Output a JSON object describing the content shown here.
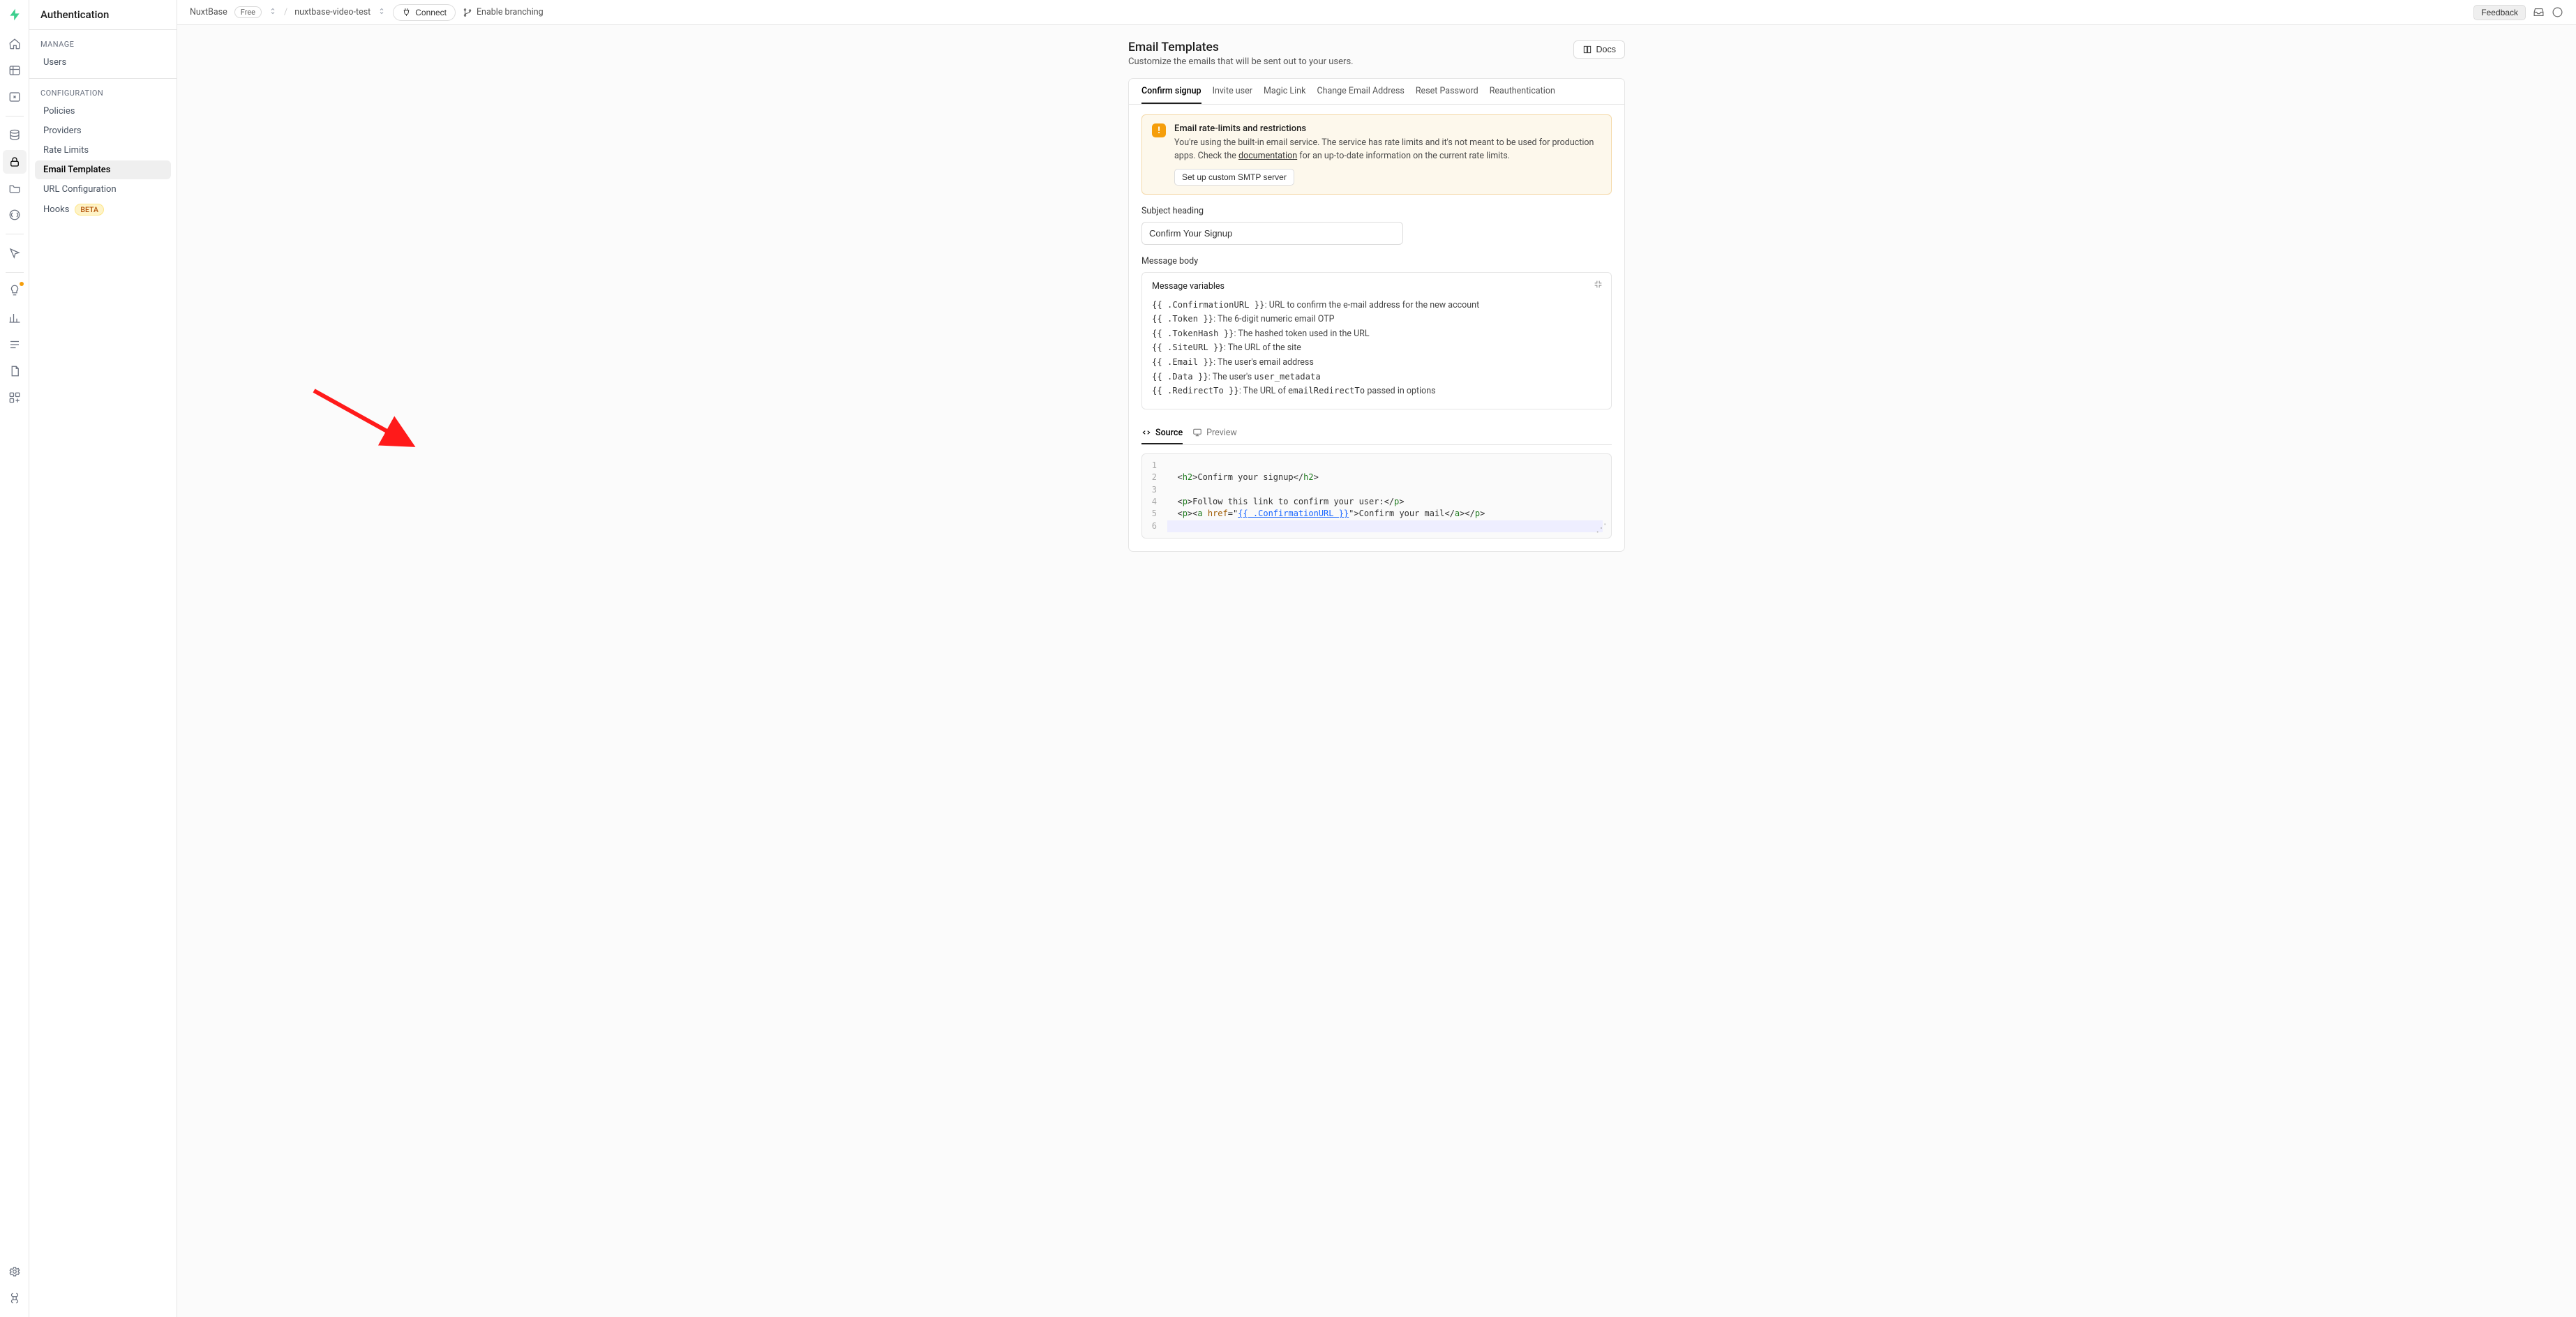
{
  "sidebar": {
    "title": "Authentication",
    "manage_header": "MANAGE",
    "config_header": "CONFIGURATION",
    "manage_items": [
      {
        "label": "Users"
      }
    ],
    "config_items": [
      {
        "label": "Policies"
      },
      {
        "label": "Providers"
      },
      {
        "label": "Rate Limits"
      },
      {
        "label": "Email Templates",
        "active": true
      },
      {
        "label": "URL Configuration"
      },
      {
        "label": "Hooks",
        "badge": "BETA"
      }
    ]
  },
  "topbar": {
    "org": "NuxtBase",
    "plan": "Free",
    "project": "nuxtbase-video-test",
    "connect": "Connect",
    "branching": "Enable branching",
    "feedback": "Feedback"
  },
  "page": {
    "title": "Email Templates",
    "subtitle": "Customize the emails that will be sent out to your users.",
    "docs": "Docs"
  },
  "tabs": [
    "Confirm signup",
    "Invite user",
    "Magic Link",
    "Change Email Address",
    "Reset Password",
    "Reauthentication"
  ],
  "notice": {
    "title": "Email rate-limits and restrictions",
    "text1": "You're using the built-in email service. The service has rate limits and it's not meant to be used for production apps. Check the ",
    "doclink": "documentation",
    "text2": " for an up-to-date information on the current rate limits.",
    "button": "Set up custom SMTP server"
  },
  "form": {
    "subject_label": "Subject heading",
    "subject_value": "Confirm Your Signup",
    "body_label": "Message body"
  },
  "vars": {
    "title": "Message variables",
    "items": [
      {
        "var": "{{ .ConfirmationURL }}",
        "desc": ": URL to confirm the e-mail address for the new account"
      },
      {
        "var": "{{ .Token }}",
        "desc": ": The 6-digit numeric email OTP"
      },
      {
        "var": "{{ .TokenHash }}",
        "desc": ": The hashed token used in the URL"
      },
      {
        "var": "{{ .SiteURL }}",
        "desc": ": The URL of the site"
      },
      {
        "var": "{{ .Email }}",
        "desc": ": The user's email address"
      },
      {
        "var": "{{ .Data }}",
        "desc_pre": ": The user's ",
        "code": "user_metadata"
      },
      {
        "var": "{{ .RedirectTo }}",
        "desc_pre": ": The URL of ",
        "code": "emailRedirectTo",
        "desc_post": " passed in options"
      }
    ]
  },
  "editor_tabs": {
    "source": "Source",
    "preview": "Preview"
  },
  "code": {
    "lines": [
      "1",
      "2",
      "3",
      "4",
      "5",
      "6"
    ],
    "l2_text": "Confirm your signup",
    "l4_text": "Follow this link to confirm your user:",
    "l5_href": "{{ .ConfirmationURL }}",
    "l5_link": "Confirm your mail"
  }
}
